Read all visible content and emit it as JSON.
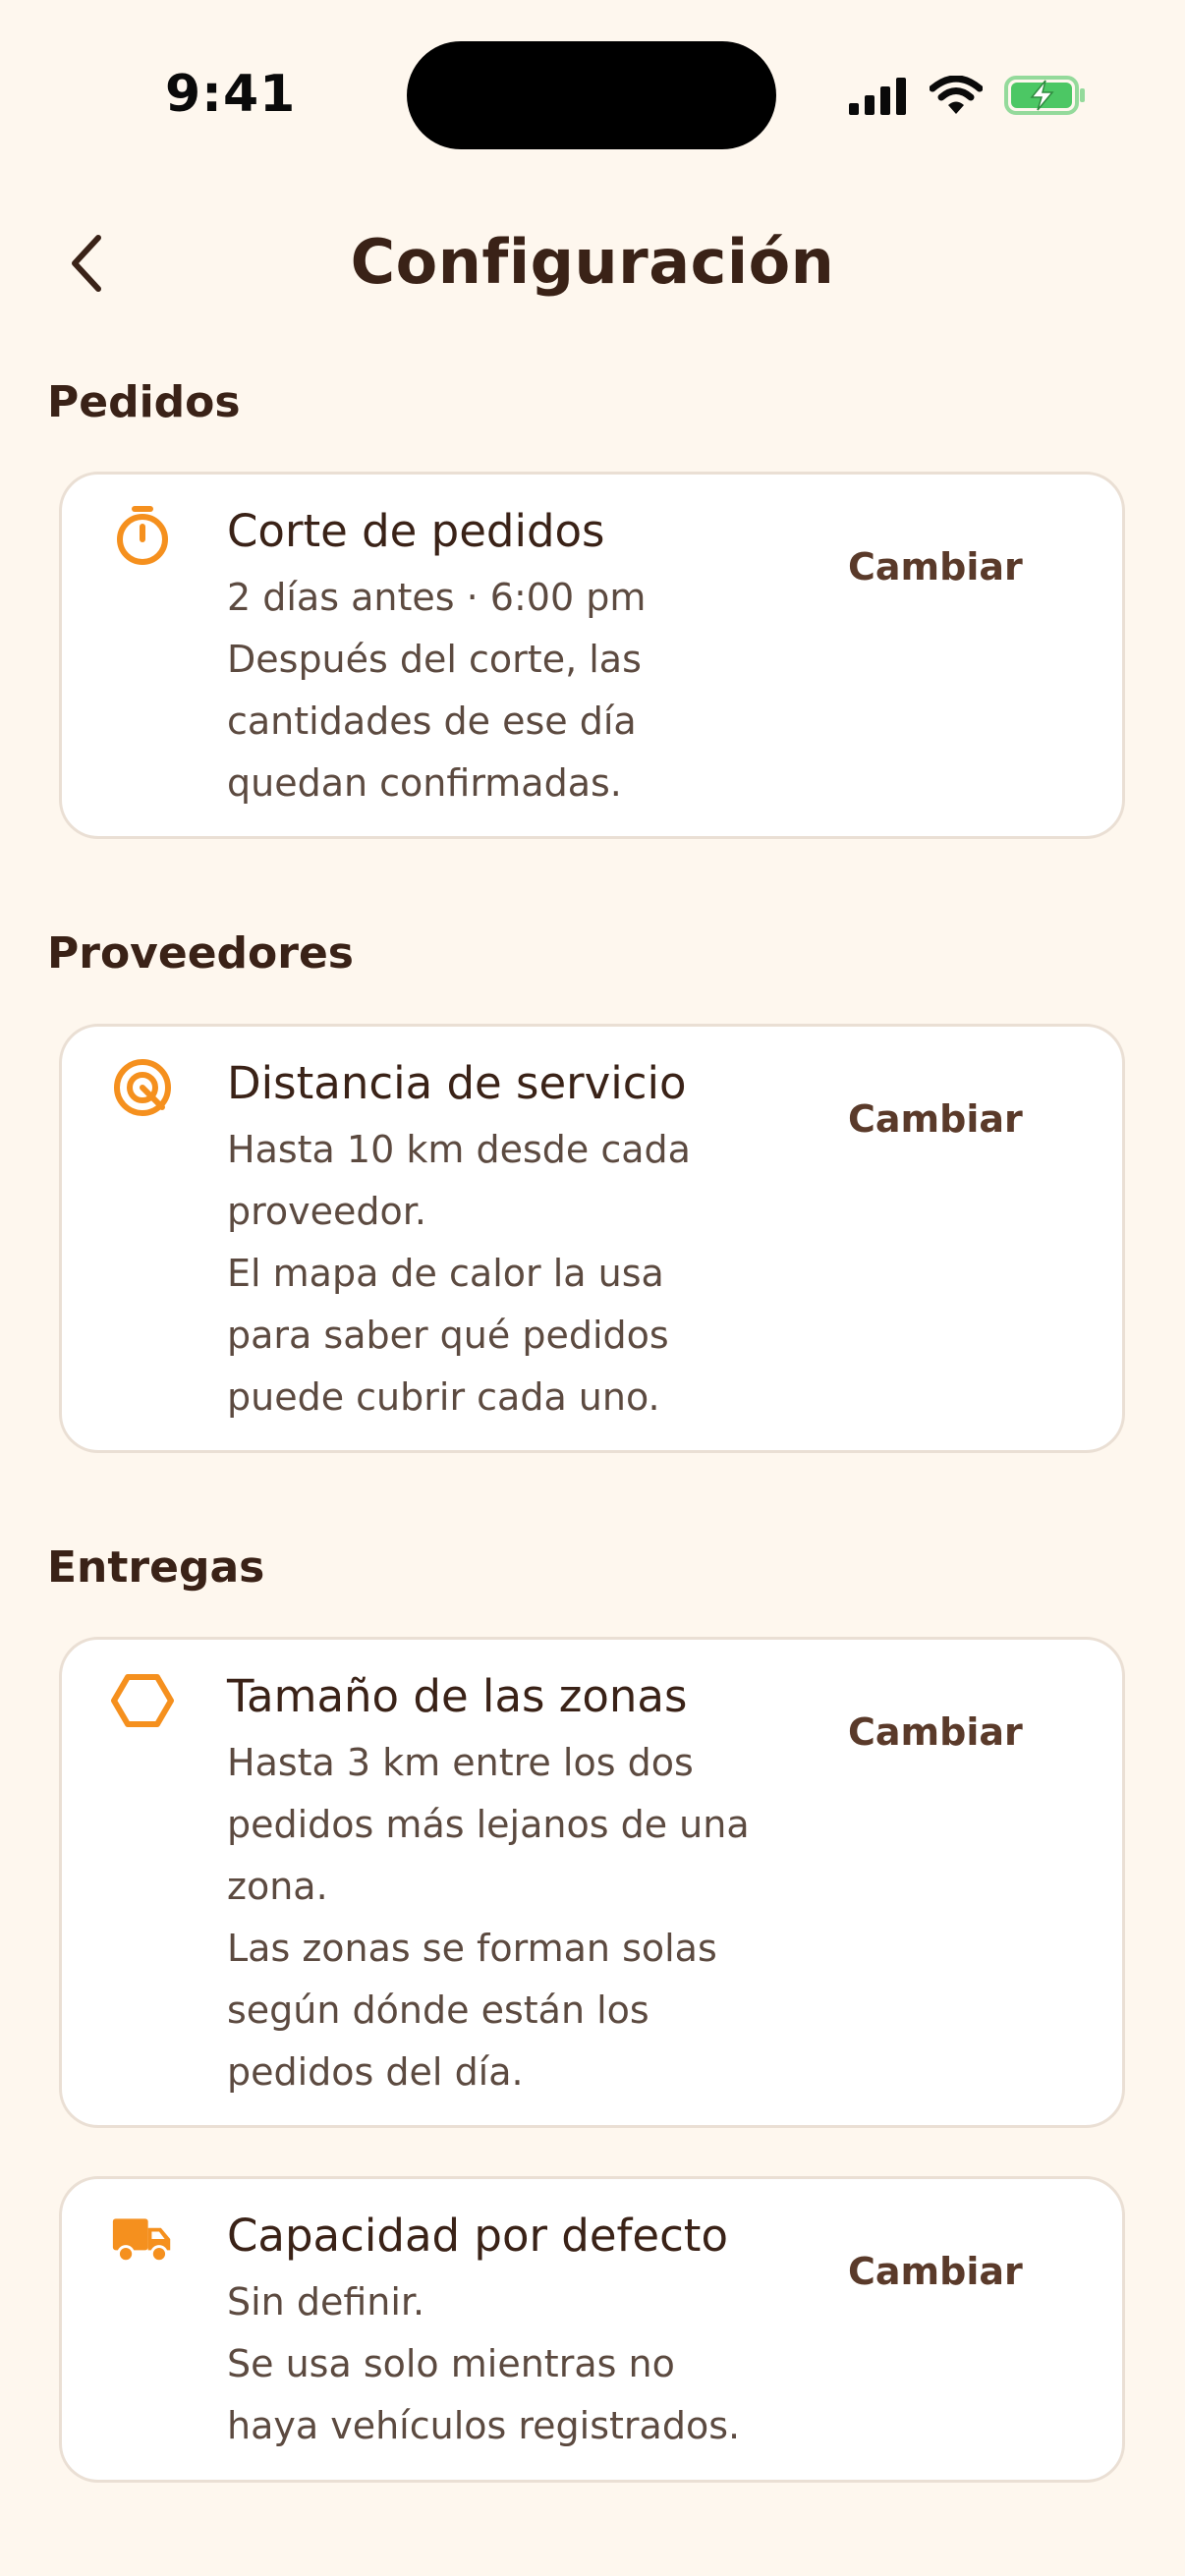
{
  "status_bar": {
    "time": "9:41"
  },
  "header": {
    "title": "Configuración"
  },
  "sections": [
    {
      "title": "Pedidos",
      "cards": [
        {
          "icon": "stopwatch-icon",
          "title": "Corte de pedidos",
          "lines": [
            "2 días antes · 6:00 pm",
            "Después del corte, las",
            "cantidades de ese día",
            "quedan confirmadas."
          ],
          "action": "Cambiar"
        }
      ]
    },
    {
      "title": "Proveedores",
      "cards": [
        {
          "icon": "target-icon",
          "title": "Distancia de servicio",
          "lines": [
            "Hasta 10 km desde cada",
            "proveedor.",
            "El mapa de calor la usa",
            "para saber qué pedidos",
            "puede cubrir cada uno."
          ],
          "action": "Cambiar"
        }
      ]
    },
    {
      "title": "Entregas",
      "cards": [
        {
          "icon": "hexagon-icon",
          "title": "Tamaño de las zonas",
          "lines": [
            "Hasta 3 km entre los dos",
            "pedidos más lejanos de una",
            "zona.",
            "Las zonas se forman solas",
            "según dónde están los",
            "pedidos del día."
          ],
          "action": "Cambiar"
        },
        {
          "icon": "truck-icon",
          "title": "Capacidad por defecto",
          "lines": [
            "Sin definir.",
            "Se usa solo mientras no",
            "haya vehículos registrados."
          ],
          "action": "Cambiar"
        }
      ]
    }
  ],
  "colors": {
    "background": "#FEF7EE",
    "accent": "#F5901E",
    "text": "#3A2217",
    "battery": "#4CC764"
  }
}
